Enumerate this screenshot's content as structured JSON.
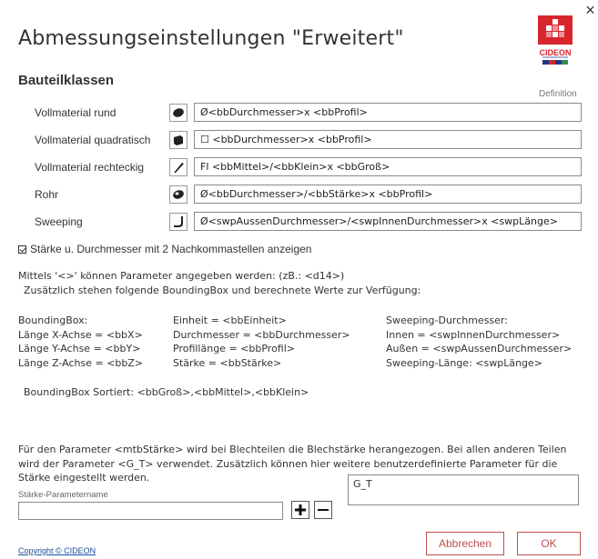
{
  "dialog": {
    "title": "Abmessungseinstellungen \"Erweitert\"",
    "close_glyph": "×",
    "logo_text": "CIDEON"
  },
  "section": {
    "title": "Bauteilklassen",
    "definition_label": "Definition"
  },
  "classes": [
    {
      "label": "Vollmaterial rund",
      "icon": "round-bar-icon",
      "value": "Ø<bbDurchmesser>x <bbProfil>"
    },
    {
      "label": "Vollmaterial quadratisch",
      "icon": "square-bar-icon",
      "value": "☐ <bbDurchmesser>x <bbProfil>"
    },
    {
      "label": "Vollmaterial rechteckig",
      "icon": "flat-bar-icon",
      "value": "Fl <bbMittel>/<bbKlein>x <bbGroß>"
    },
    {
      "label": "Rohr",
      "icon": "tube-icon",
      "value": "Ø<bbDurchmesser>/<bbStärke>x <bbProfil>"
    },
    {
      "label": "Sweeping",
      "icon": "sweep-icon",
      "value": "Ø<swpAussenDurchmesser>/<swpInnenDurchmesser>x <swpLänge>"
    }
  ],
  "checkbox": {
    "label": "Stärke u. Durchmesser mit 2 Nachkommastellen anzeigen",
    "checked": true
  },
  "info": {
    "line1": "Mittels '<>' können Parameter angegeben werden: (zB.: <d14>)",
    "line2": "Zusätzlich stehen folgende BoundingBox und berechnete Werte zur Verfügung:",
    "col1": [
      "BoundingBox:",
      "Länge X-Achse = <bbX>",
      "Länge Y-Achse = <bbY>",
      "Länge Z-Achse = <bbZ>"
    ],
    "col2": [
      "Einheit = <bbEinheit>",
      "Durchmesser = <bbDurchmesser>",
      "Profillänge = <bbProfil>",
      "Stärke = <bbStärke>"
    ],
    "col3": [
      "Sweeping-Durchmesser:",
      "Innen = <swpInnenDurchmesser>",
      "Außen = <swpAussenDurchmesser>",
      "Sweeping-Länge: <swpLänge>"
    ],
    "sorted": "BoundingBox Sortiert: <bbGroß>,<bbMittel>,<bbKlein>"
  },
  "paragraph": "Für den Parameter <mtbStärke> wird bei Blechteilen die Blechstärke herangezogen. Bei allen anderen Teilen wird der Parameter <G_T> verwendet. Zusätzlich können hier weitere benutzerdefinierte Parameter für die Stärke eingestellt werden.",
  "param": {
    "label": "Stärke-Parametername",
    "input_value": "",
    "list": [
      "G_T"
    ]
  },
  "footer": {
    "copyright": "Copyright © CIDEON",
    "cancel": "Abbrechen",
    "ok": "OK"
  },
  "colors": {
    "accent": "#c0504d",
    "link": "#1a4fa0",
    "logo_red": "#d9262e",
    "logo_blue": "#1f3a8a"
  }
}
